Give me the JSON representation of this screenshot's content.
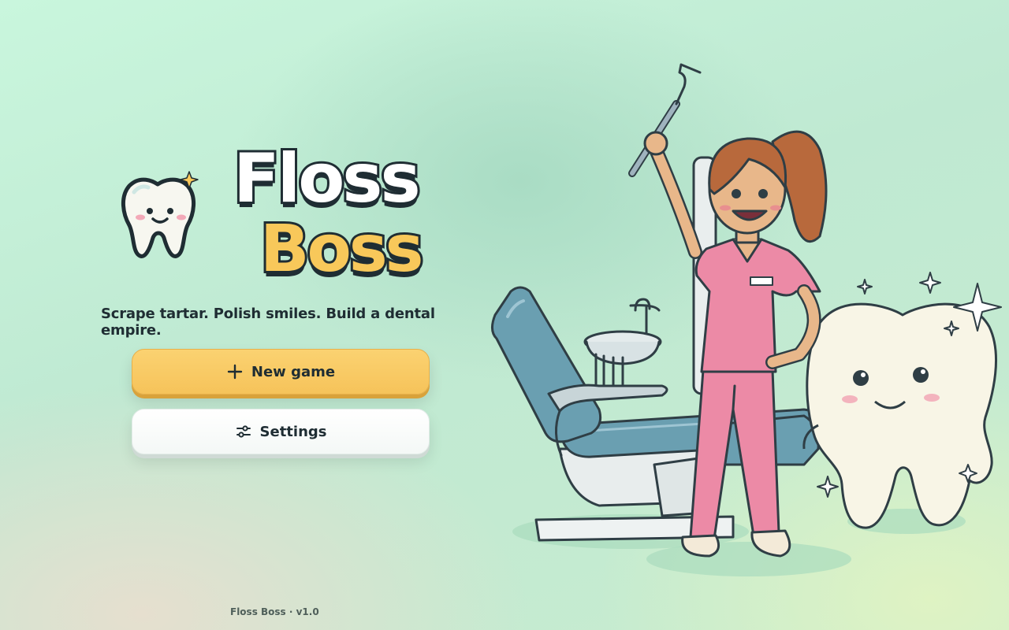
{
  "title": {
    "line1": "Floss",
    "line2": "Boss"
  },
  "tagline": "Scrape tartar. Polish smiles. Build a dental empire.",
  "menu": {
    "new_game": {
      "label": "New game",
      "icon": "plus-icon"
    },
    "settings": {
      "label": "Settings",
      "icon": "sliders-icon"
    }
  },
  "footer": {
    "version": "Floss Boss · v1.0"
  },
  "colors": {
    "accent_yellow": "#f8c85a",
    "outline": "#1f2d33",
    "scrubs_pink": "#ec8aa6",
    "chair_blue": "#6a9fb1"
  }
}
